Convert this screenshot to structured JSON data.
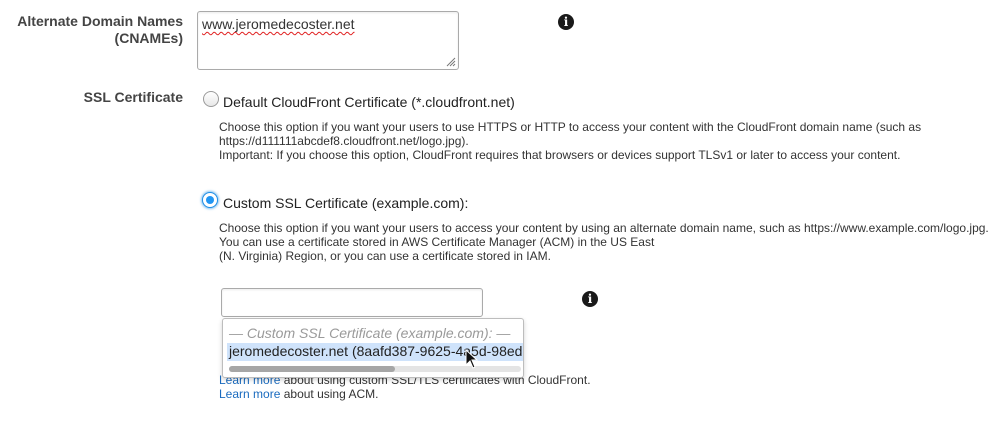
{
  "cnames": {
    "label_line1": "Alternate Domain Names",
    "label_line2": "(CNAMEs)",
    "value": "www.jeromedecoster.net"
  },
  "ssl": {
    "label": "SSL Certificate",
    "default_option": {
      "title": "Default CloudFront Certificate (*.cloudfront.net)",
      "desc_line1": "Choose this option if you want your users to use HTTPS or HTTP to access your content with the CloudFront domain name (such as",
      "desc_line2": "https://d111111abcdef8.cloudfront.net/logo.jpg).",
      "desc_line3": "Important: If you choose this option, CloudFront requires that browsers or devices support TLSv1 or later to access your content.",
      "selected": false
    },
    "custom_option": {
      "title": "Custom SSL Certificate (example.com):",
      "desc_line1": "Choose this option if you want your users to access your content by using an alternate domain name, such as https://www.example.com/logo.jpg.",
      "desc_line2": "You can use a certificate stored in AWS Certificate Manager (ACM) in the US East",
      "desc_line3": "(N. Virginia) Region, or you can use a certificate stored in IAM.",
      "selected": true
    },
    "certificate_input_value": "",
    "dropdown": {
      "group_label": "— Custom SSL Certificate (example.com): —",
      "options": [
        "jeromedecoster.net (8aafd387-9625-4a5d-98ed"
      ]
    },
    "learn_more_1": {
      "link": "Learn more",
      "text": "about using custom SSL/TLS certificates with CloudFront."
    },
    "learn_more_2": {
      "link": "Learn more",
      "text": "about using ACM."
    }
  },
  "colors": {
    "accent": "#2196f3",
    "link": "#1a6bbf",
    "highlight": "#cfe3fb"
  }
}
